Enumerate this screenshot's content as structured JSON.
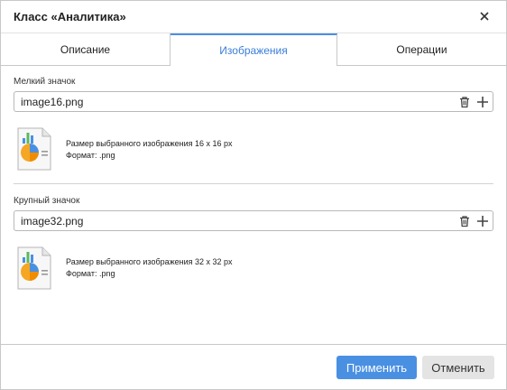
{
  "dialog": {
    "title": "Класс «Аналитика»",
    "close_icon": "close-icon"
  },
  "tabs": [
    {
      "label": "Описание",
      "active": false
    },
    {
      "label": "Изображения",
      "active": true
    },
    {
      "label": "Операции",
      "active": false
    }
  ],
  "small_icon": {
    "label": "Мелкий значок",
    "value": "image16.png",
    "size_text": "Размер выбранного изображения 16 x 16 px",
    "format_text": "Формат: .png"
  },
  "large_icon": {
    "label": "Крупный значок",
    "value": "image32.png",
    "size_text": "Размер выбранного изображения 32 x 32 px",
    "format_text": "Формат: .png"
  },
  "footer": {
    "apply_label": "Применить",
    "cancel_label": "Отменить"
  },
  "colors": {
    "accent": "#4a90e2",
    "accent_text": "#3a7ed8",
    "cancel_bg": "#e4e4e4"
  },
  "icons": [
    "close-icon",
    "trash-icon",
    "plus-icon",
    "report-document-icon"
  ]
}
